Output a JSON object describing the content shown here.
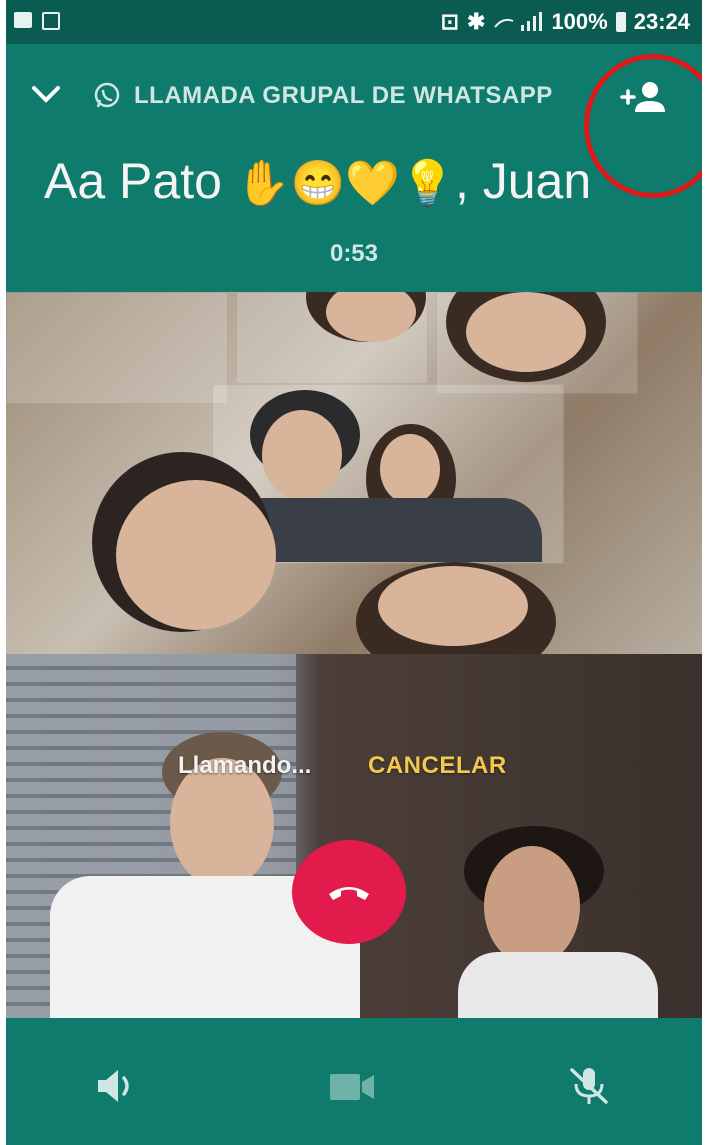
{
  "status_bar": {
    "battery": "100%",
    "time": "23:24"
  },
  "header": {
    "call_label": "LLAMADA GRUPAL DE WHATSAPP",
    "participants_text": "Aa Pato",
    "participants_emoji": "✋😁💛💡",
    "participants_suffix": ", Juan",
    "duration": "0:53"
  },
  "call": {
    "status_text": "Llamando...",
    "cancel_label": "CANCELAR"
  },
  "icons": {
    "back": "chevron-down-icon",
    "whatsapp": "whatsapp-icon",
    "add_participant": "add-person-icon",
    "hangup": "phone-hangup-icon",
    "speaker": "speaker-icon",
    "video": "video-camera-icon",
    "mute": "mic-off-icon"
  },
  "colors": {
    "header_bg": "#0f7b6c",
    "status_bg": "#0a5c50",
    "cancel": "#f2c94c",
    "hangup": "#e21b4c",
    "highlight_circle": "#e01818"
  }
}
